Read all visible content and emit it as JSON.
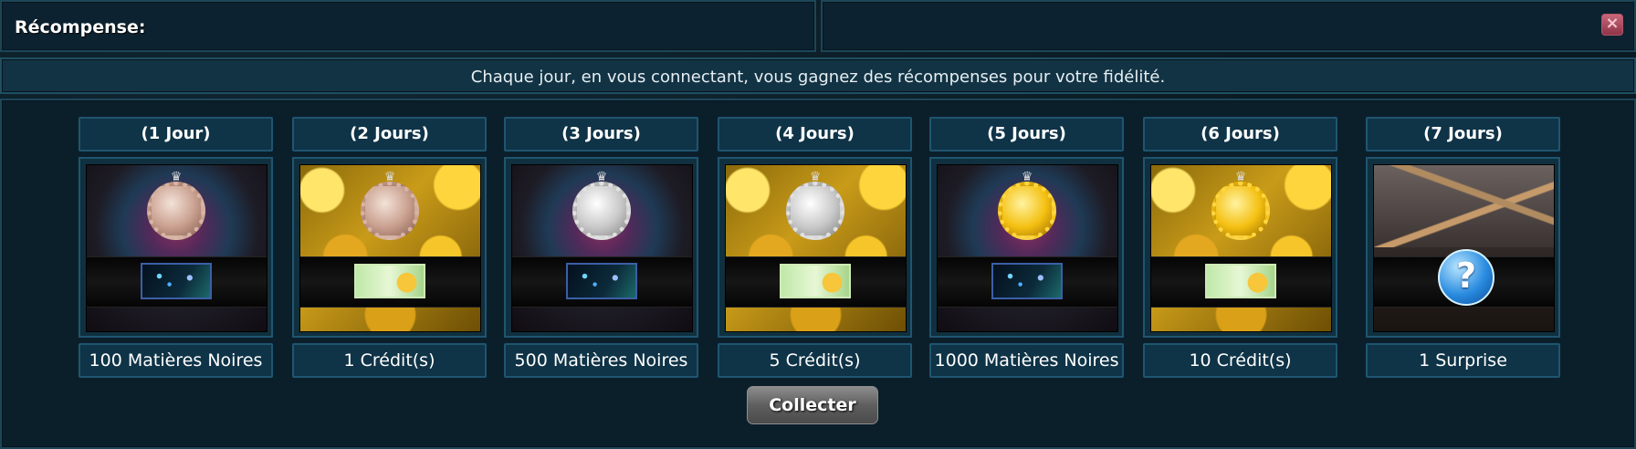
{
  "header": {
    "title": "Récompense:",
    "close_icon": "close-icon"
  },
  "info": {
    "message": "Chaque jour, en vous connectant, vous gagnez des récompenses pour votre fidélité."
  },
  "rewards": [
    {
      "day": "(1 Jour)",
      "label": "100 Matières Noires",
      "medal": "bronze",
      "background": "nebula",
      "item_icon": "dark-matter-icon"
    },
    {
      "day": "(2 Jours)",
      "label": "1 Crédit(s)",
      "medal": "bronze",
      "background": "coins",
      "item_icon": "credits-icon"
    },
    {
      "day": "(3 Jours)",
      "label": "500 Matières Noires",
      "medal": "silver",
      "background": "nebula",
      "item_icon": "dark-matter-icon"
    },
    {
      "day": "(4 Jours)",
      "label": "5 Crédit(s)",
      "medal": "silver",
      "background": "coins",
      "item_icon": "credits-icon"
    },
    {
      "day": "(5 Jours)",
      "label": "1000 Matières Noires",
      "medal": "gold",
      "background": "nebula",
      "item_icon": "dark-matter-icon"
    },
    {
      "day": "(6 Jours)",
      "label": "10 Crédit(s)",
      "medal": "gold",
      "background": "coins",
      "item_icon": "credits-icon"
    },
    {
      "day": "(7 Jours)",
      "label": "1 Surprise",
      "medal": "",
      "background": "chest",
      "item_icon": "question-mark-icon"
    }
  ],
  "collect_button": {
    "label": "Collecter"
  },
  "colors": {
    "panel_bg": "#0d2230",
    "panel_border": "#1d4658",
    "label_bg": "#0f3347",
    "button_gray": "#6b6b6b",
    "close_red": "#c8677a"
  }
}
